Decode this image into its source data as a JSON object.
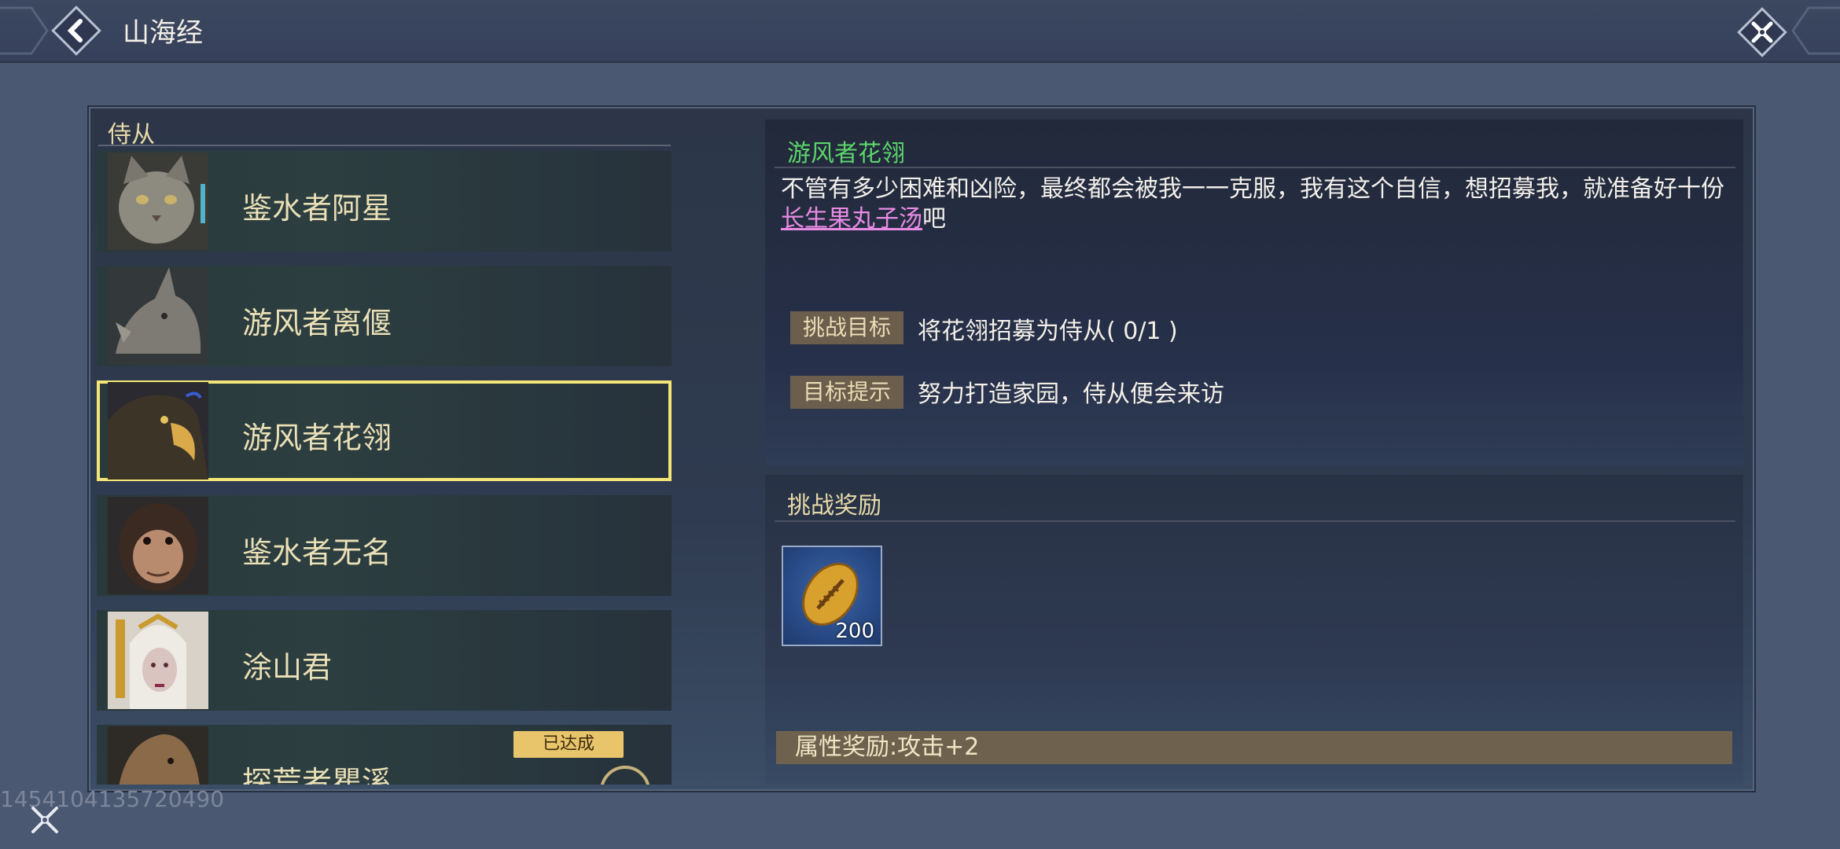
{
  "header": {
    "title": "山海经",
    "back_icon": "back-arrow-icon",
    "close_icon": "close-icon"
  },
  "list": {
    "section_title": "侍从",
    "items": [
      {
        "name": "鉴水者阿星",
        "portrait": "cat-portrait"
      },
      {
        "name": "游风者离偃",
        "portrait": "rhino-portrait"
      },
      {
        "name": "游风者花翎",
        "portrait": "eagle-portrait",
        "selected": true
      },
      {
        "name": "鉴水者无名",
        "portrait": "ape-portrait"
      },
      {
        "name": "涂山君",
        "portrait": "fox-spirit-portrait"
      },
      {
        "name": "探荒者瞿溪",
        "portrait": "capybara-portrait",
        "badge": "已达成"
      }
    ]
  },
  "detail": {
    "name": "游风者花翎",
    "desc_before": "不管有多少困难和凶险，最终都会被我一一克服，我有这个自信，想招募我，就准备好十份",
    "desc_link": "长生果丸子汤",
    "desc_after": "吧",
    "goal_label": "挑战目标",
    "goal_text": "将花翎招募为侍从( 0/1 )",
    "hint_label": "目标提示",
    "hint_text": "努力打造家园，侍从便会来访"
  },
  "rewards": {
    "section_title": "挑战奖励",
    "items": [
      {
        "icon": "gold-shell-coin-icon",
        "count": "200"
      }
    ],
    "attribute": "属性奖励:攻击+2"
  },
  "footer": {
    "debug_id": "1454104135720490"
  },
  "colors": {
    "selected_border": "#f3e676",
    "detail_title": "#5cd66b",
    "link": "#e98be4",
    "section_title": "#e6d9a8"
  }
}
